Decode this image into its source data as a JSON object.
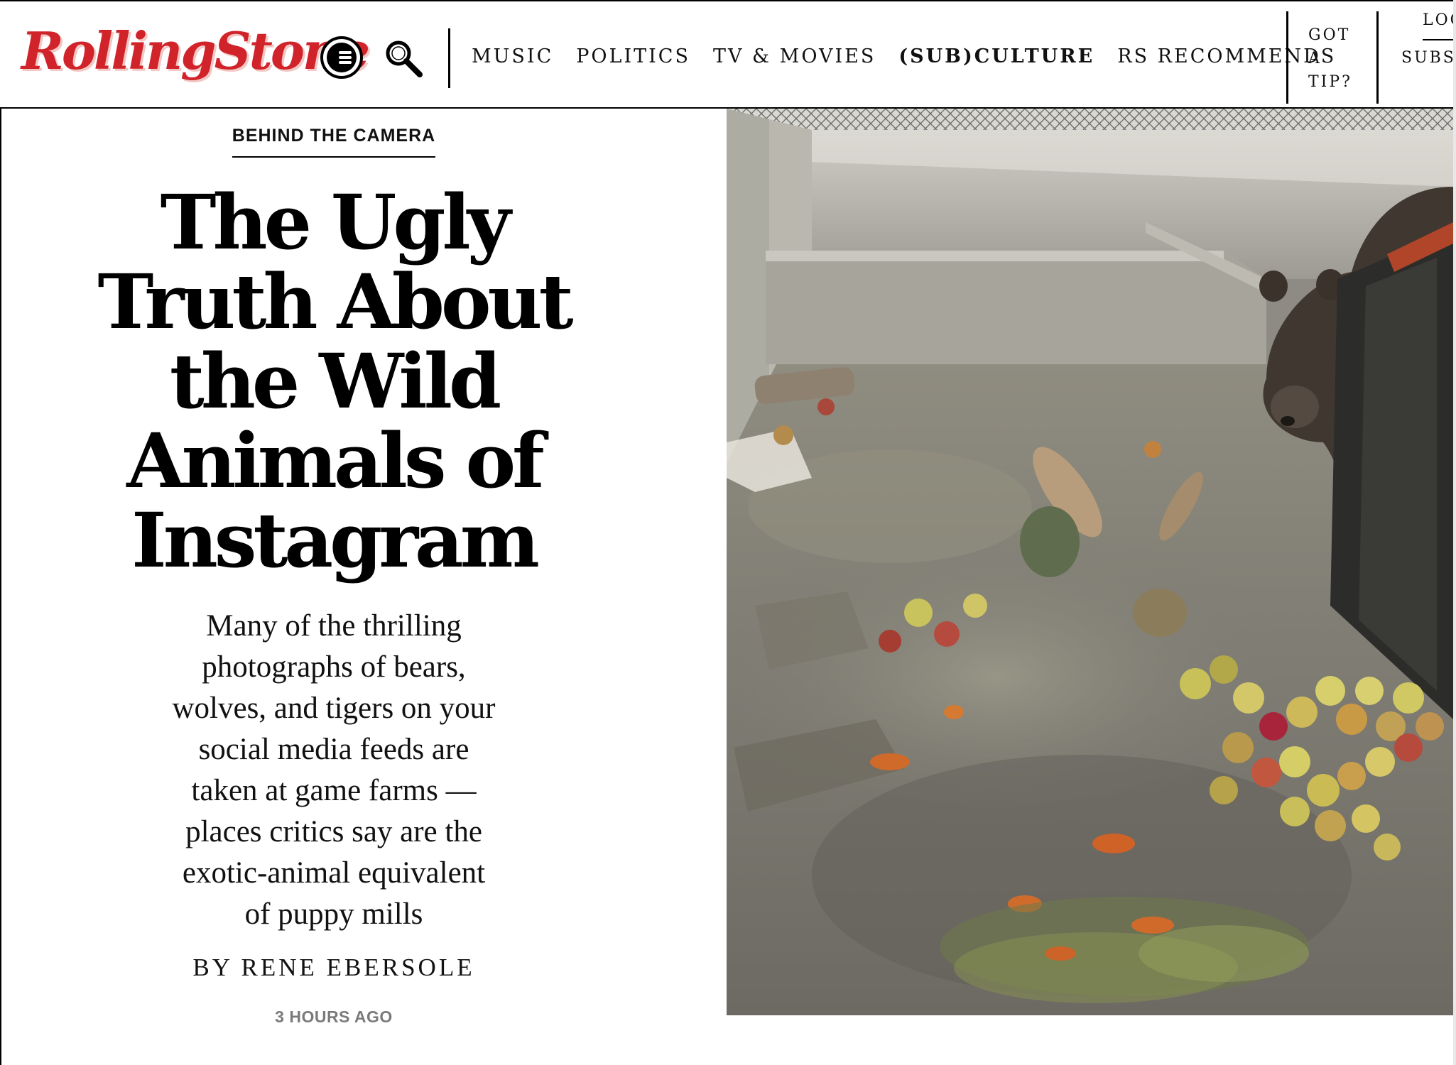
{
  "header": {
    "logo_text": "RollingStone",
    "nav_items": [
      "MUSIC",
      "POLITICS",
      "TV & MOVIES",
      "(SUB)CULTURE",
      "RS RECOMMENDS"
    ],
    "tip_lines": [
      "GOT",
      "A",
      "TIP?"
    ],
    "login_label": "LOG",
    "subscribe_label": "SUBSC"
  },
  "article": {
    "rubric": "BEHIND THE CAMERA",
    "headline_lines": [
      "The Ugly",
      "Truth About",
      "the Wild",
      "Animals of",
      "Instagram"
    ],
    "dek_lines": [
      "Many of the thrilling",
      "photographs of bears,",
      "wolves, and tigers on your",
      "social media feeds are",
      "taken at game farms —",
      "places critics say are the",
      "exotic-animal equivalent",
      "of puppy mills"
    ],
    "byline": "BY RENE EBERSOLE",
    "timestamp": "3 HOURS AGO"
  },
  "colors": {
    "logo_red": "#d0232a",
    "timestamp_gray": "#7a7a7a"
  },
  "icons": {
    "menu": "menu-icon",
    "search": "search-icon"
  }
}
